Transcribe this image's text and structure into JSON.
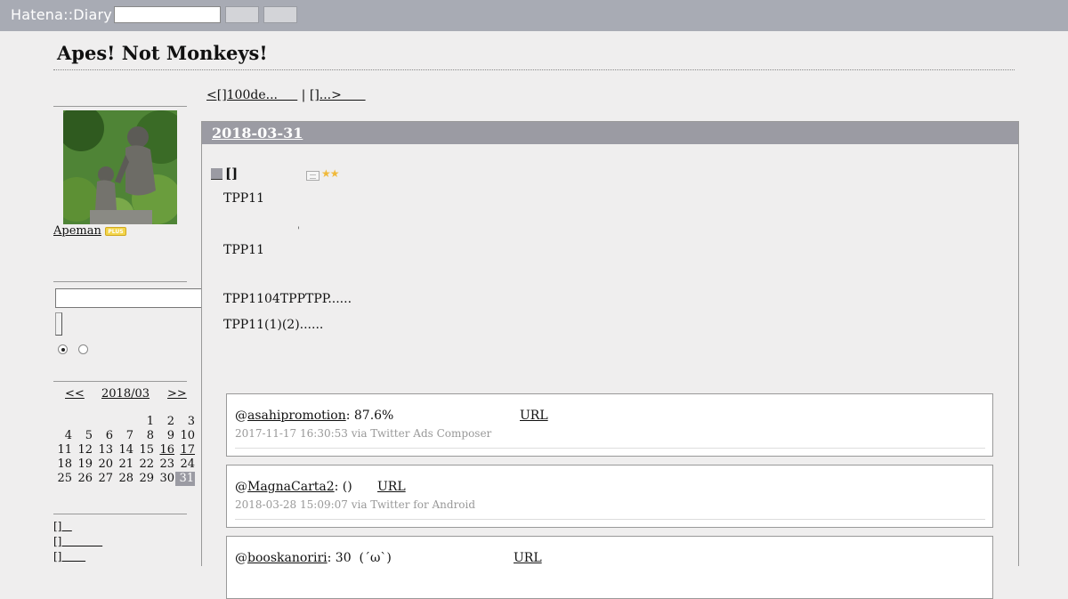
{
  "header": {
    "logo": "Hatena::Diary",
    "search_value": ""
  },
  "blog": {
    "title": "Apes! Not Monkeys!"
  },
  "sidebar": {
    "user_name": "Apeman",
    "plus_badge": "PLUS",
    "search_value": "",
    "calendar": {
      "prev": "<<",
      "month": "2018/03",
      "next": ">>",
      "weeks": [
        [
          "",
          "",
          "",
          "",
          "1",
          "2",
          "3"
        ],
        [
          "4",
          "5",
          "6",
          "7",
          "8",
          "9",
          "10"
        ],
        [
          "11",
          "12",
          "13",
          "14",
          "15",
          "16",
          "17"
        ],
        [
          "18",
          "19",
          "20",
          "21",
          "22",
          "23",
          "24"
        ],
        [
          "25",
          "26",
          "27",
          "28",
          "29",
          "30",
          "31"
        ]
      ],
      "linked_days": [
        "16",
        "17"
      ],
      "selected_day": "31"
    },
    "links": [
      "[]   ",
      "[]            ",
      "[]       "
    ]
  },
  "main": {
    "pager_prev": "<[]100de...     ",
    "pager_sep": " | ",
    "pager_next": "[]...>      ",
    "date": "2018-03-31",
    "entry_title": "[]",
    "stars": "★★",
    "body": [
      "TPP11",
      "TPP11",
      "TPP1104TPPTPP......",
      "TPP11(1)(2)......"
    ],
    "tick": "'",
    "tweets": [
      {
        "user": "asahipromotion",
        "text": ": 87.6%",
        "url_label": "URL",
        "meta": "2017-11-17 16:30:53 via Twitter Ads Composer"
      },
      {
        "user": "MagnaCarta2",
        "text": ": ()",
        "url_label": "URL",
        "meta": "2018-03-28 15:09:07 via Twitter for Android"
      },
      {
        "user": "booskanoriri",
        "text": ": 30  (´ω`)",
        "url_label": "URL",
        "meta": ""
      }
    ]
  }
}
